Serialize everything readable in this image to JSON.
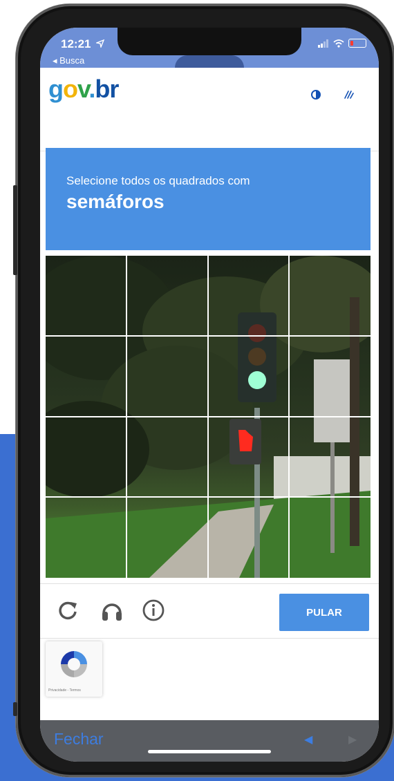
{
  "status_bar": {
    "time": "12:21",
    "back_label": "◂ Busca"
  },
  "header": {
    "logo": {
      "g": "g",
      "o": "o",
      "v": "v",
      "dot": ".",
      "br": "br"
    },
    "contrast_icon": "contrast-icon",
    "accessibility_icon": "sign-language-icon"
  },
  "captcha": {
    "instruction": "Selecione todos os quadrados com",
    "target": "semáforos",
    "grid_rows": 4,
    "grid_cols": 4,
    "reload_icon": "reload-icon",
    "audio_icon": "headphones-icon",
    "info_icon": "info-icon",
    "skip_label": "PULAR",
    "badge_terms": "Privacidade - Termos"
  },
  "browser_bar": {
    "close_label": "Fechar",
    "back_arrow": "◀",
    "forward_arrow": "▶"
  },
  "colors": {
    "accent": "#4a90e2",
    "page_background_band": "#3b6fd1",
    "status_bar": "#6d8fd6",
    "bottom_bar": "#595c61"
  }
}
